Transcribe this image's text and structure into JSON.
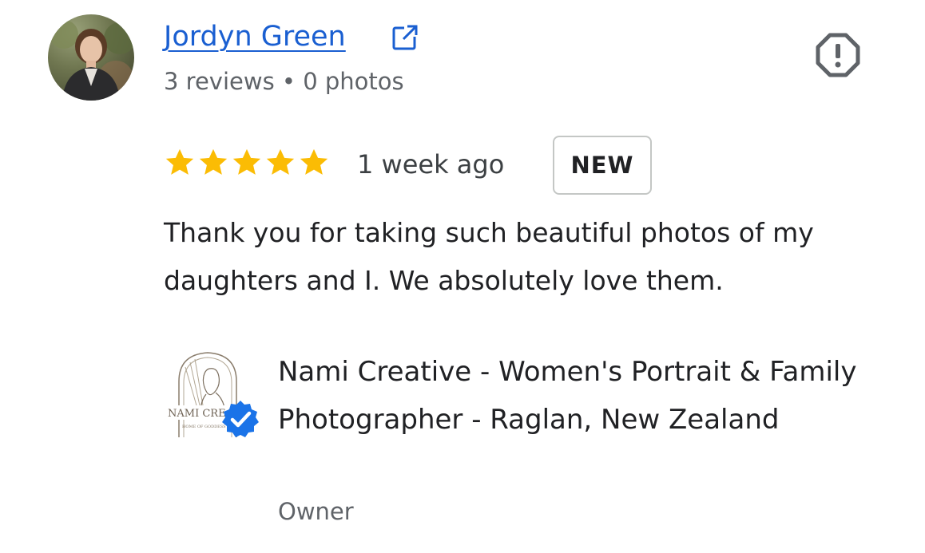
{
  "reviewer": {
    "name": "Jordyn Green",
    "meta": "3 reviews • 0 photos"
  },
  "review": {
    "rating": 5,
    "max_rating": 5,
    "time": "1 week ago",
    "badge": "NEW",
    "text": "Thank you for taking such beautiful photos of my daughters and I. We absolutely love them."
  },
  "owner_response": {
    "business_name": "Nami Creative - Women's Portrait & Family Photographer - Raglan, New Zealand",
    "role": "Owner",
    "logo_text": "NAMI CREA",
    "logo_tagline": "HOME OF GODDESS"
  },
  "colors": {
    "link": "#1a5fd1",
    "star": "#fbbc04",
    "verified": "#1a73e8",
    "meta_text": "#5f6368",
    "icon_gray": "#5f6368"
  },
  "icons": {
    "external_link": "external-link-icon",
    "report": "report-icon",
    "star": "star-icon",
    "verified": "verified-check-icon"
  }
}
